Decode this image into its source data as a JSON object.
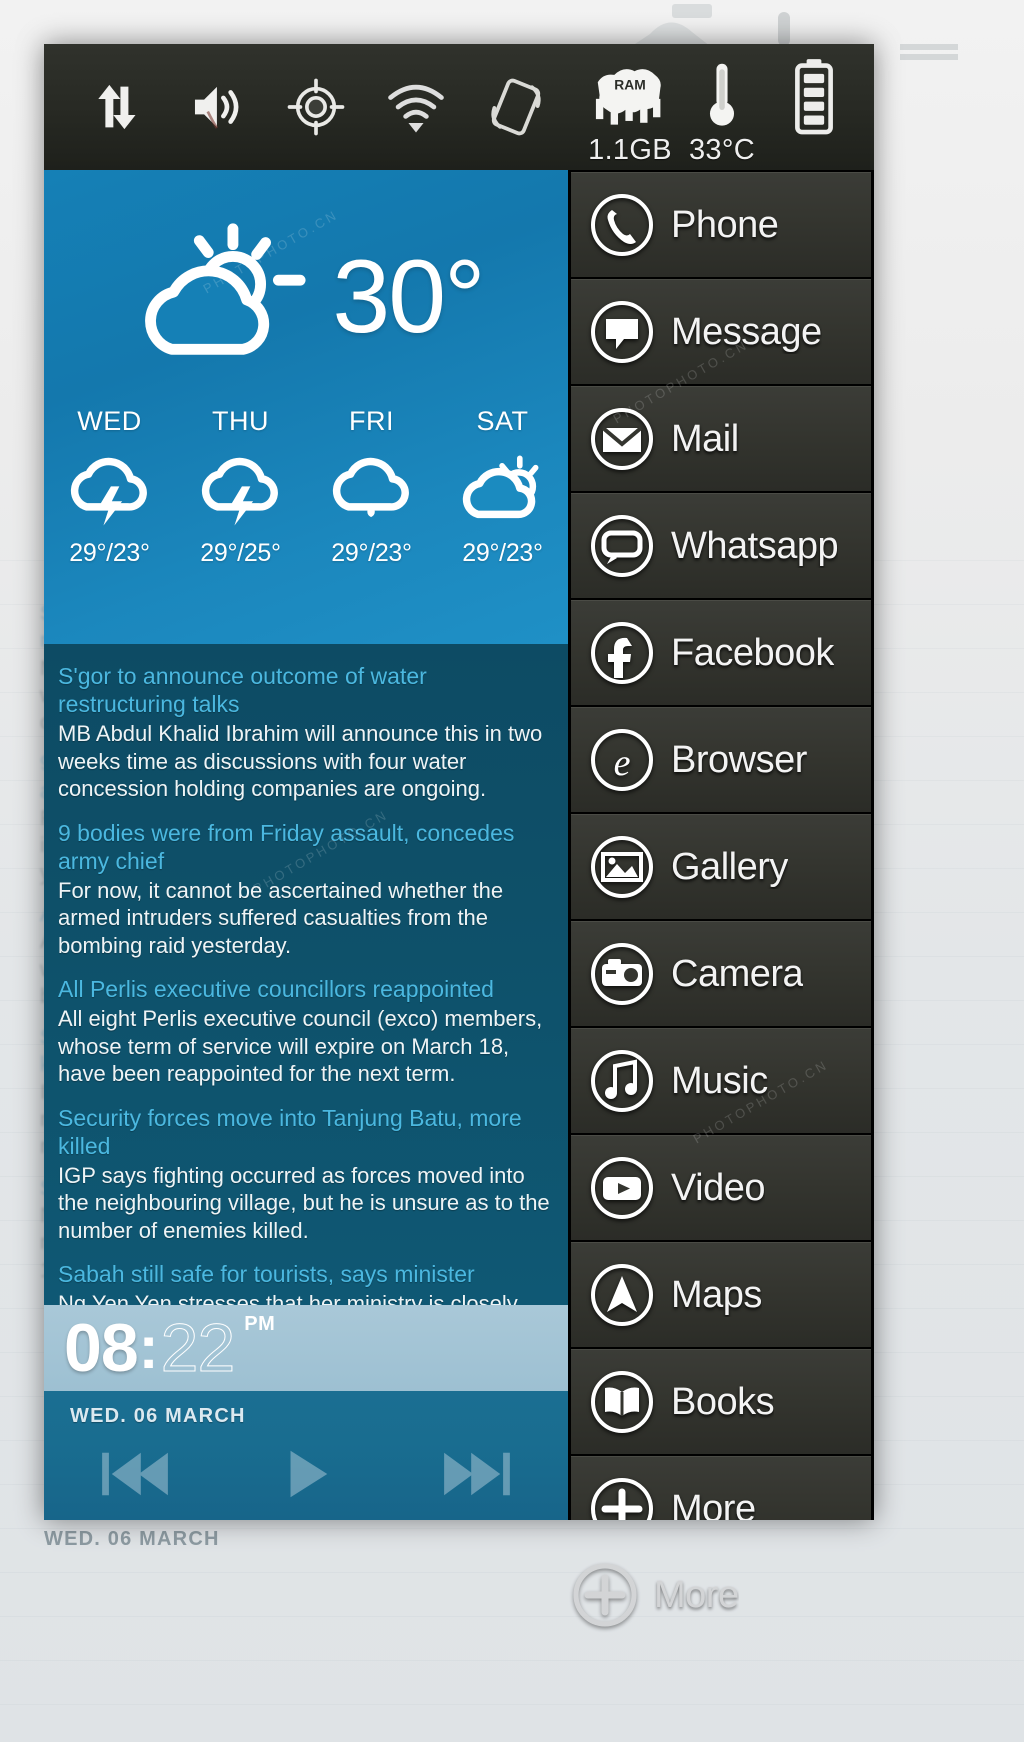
{
  "statusbar": {
    "toggles": [
      {
        "name": "data-sync-toggle",
        "icon": "data-transfer-icon"
      },
      {
        "name": "sound-toggle",
        "icon": "speaker-icon"
      },
      {
        "name": "gps-toggle",
        "icon": "location-crosshair-icon"
      },
      {
        "name": "wifi-toggle",
        "icon": "wifi-icon"
      },
      {
        "name": "rotation-toggle",
        "icon": "screen-rotate-icon"
      }
    ],
    "ram": {
      "label": "RAM",
      "value": "1.1GB",
      "icon": "ram-chip-icon"
    },
    "temperature": {
      "value": "33°C",
      "icon": "thermometer-icon"
    },
    "battery": {
      "icon": "battery-icon"
    }
  },
  "weather": {
    "current_temp": "30°",
    "current_icon": "sun-behind-cloud-icon",
    "forecast": [
      {
        "day": "WED",
        "icon": "thunderstorm-icon",
        "temps": "29°/23°"
      },
      {
        "day": "THU",
        "icon": "thunderstorm-icon",
        "temps": "29°/25°"
      },
      {
        "day": "FRI",
        "icon": "rain-cloud-icon",
        "temps": "29°/23°"
      },
      {
        "day": "SAT",
        "icon": "sun-behind-cloud-icon",
        "temps": "29°/23°"
      }
    ]
  },
  "news": {
    "articles": [
      {
        "headline": "S'gor to announce outcome of water restructuring talks",
        "body": "MB Abdul Khalid Ibrahim will announce this in two weeks time as discussions with four water concession holding companies are ongoing."
      },
      {
        "headline": "9 bodies were from Friday assault, concedes army chief",
        "body": "For now, it cannot be ascertained whether the armed intruders suffered casualties from the bombing raid yesterday."
      },
      {
        "headline": "All Perlis executive councillors reappointed",
        "body": "All eight Perlis executive council (exco)  members, whose term of service will expire on March 18, have been reappointed for the next term."
      },
      {
        "headline": "Security forces move into Tanjung Batu, more killed",
        "body": "IGP says fighting occurred as forces moved into the neighbouring village, but he is unsure as to the number of enemies killed."
      },
      {
        "headline": "Sabah still safe for tourists, says minister",
        "body": "Ng Yen Yen stresses that her ministry is closely monitoring the situation and are getting updates at 12-hour intervals from the Sabah Tourism Board."
      }
    ]
  },
  "clock": {
    "hours": "08",
    "separator": ":",
    "minutes": "22",
    "ampm": "PM",
    "date": "WED. 06 MARCH"
  },
  "media_controls": [
    {
      "name": "previous-track-button",
      "icon": "skip-previous-icon"
    },
    {
      "name": "play-button",
      "icon": "play-icon"
    },
    {
      "name": "next-track-button",
      "icon": "skip-next-icon"
    }
  ],
  "applist": {
    "items": [
      {
        "label": "Phone",
        "icon": "phone-handset-icon"
      },
      {
        "label": "Message",
        "icon": "speech-bubble-icon"
      },
      {
        "label": "Mail",
        "icon": "envelope-icon"
      },
      {
        "label": "Whatsapp",
        "icon": "chat-bubble-icon"
      },
      {
        "label": "Facebook",
        "icon": "facebook-f-icon"
      },
      {
        "label": "Browser",
        "icon": "internet-explorer-e-icon"
      },
      {
        "label": "Gallery",
        "icon": "photo-mountain-icon"
      },
      {
        "label": "Camera",
        "icon": "camera-icon"
      },
      {
        "label": "Music",
        "icon": "music-note-icon"
      },
      {
        "label": "Video",
        "icon": "video-play-icon"
      },
      {
        "label": "Maps",
        "icon": "navigation-arrow-icon"
      },
      {
        "label": "Books",
        "icon": "open-book-icon"
      },
      {
        "label": "More",
        "icon": "plus-circle-icon"
      }
    ]
  },
  "background_ghost": {
    "date": "WED. 06 MARCH",
    "app_label": "More"
  },
  "colors": {
    "weather_blue": "#1580b6",
    "news_blue": "#0e5069",
    "headline_cyan": "#4bb8e0",
    "app_row_dark": "#34352f",
    "statusbar_dark": "#272923",
    "clock_band": "#a9c8d8",
    "date_band": "#196d90"
  }
}
